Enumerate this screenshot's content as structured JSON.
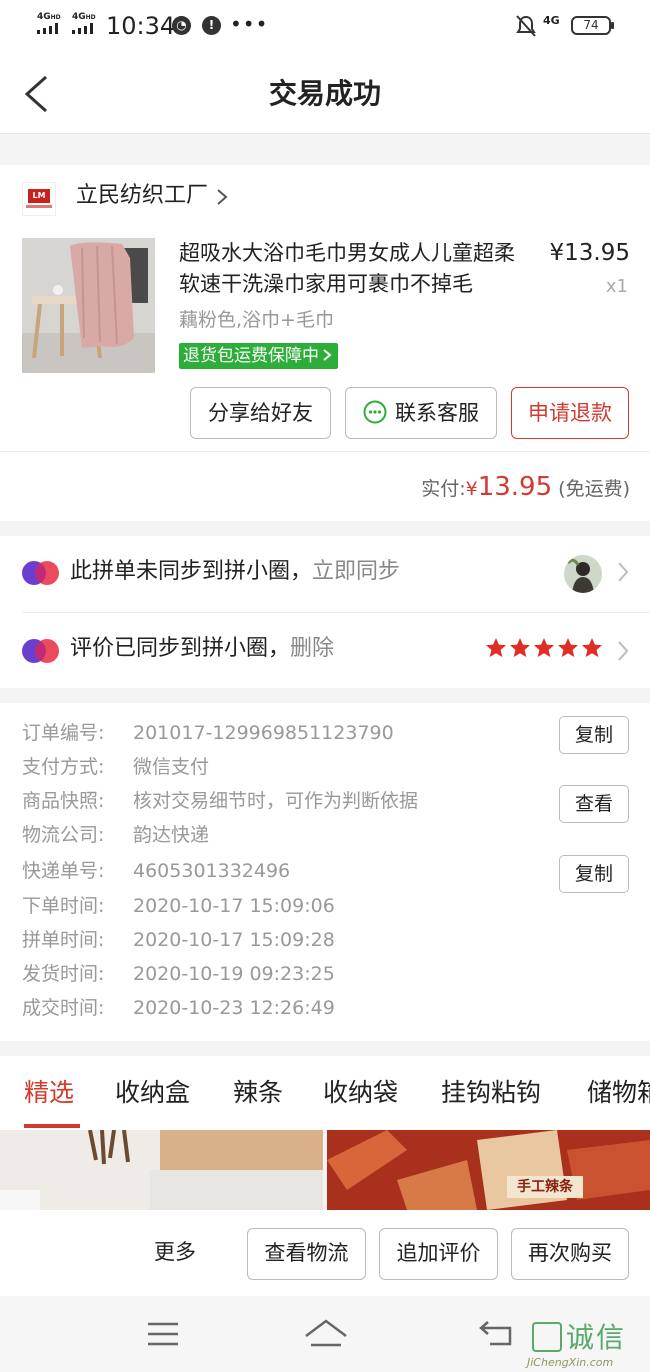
{
  "status_bar": {
    "net1": "4G",
    "net1_sup": "HD",
    "net2": "4G",
    "net2_sup": "HD",
    "time": "10:34",
    "network_right": "4G",
    "battery": "74"
  },
  "header": {
    "title": "交易成功"
  },
  "order": {
    "shop_logo_text": "LM",
    "shop_name": "立民纺织工厂",
    "product_title": "超吸水大浴巾毛巾男女成人儿童超柔软速干洗澡巾家用可裹巾不掉毛",
    "price": "¥13.95",
    "qty": "x1",
    "spec": "藕粉色,浴巾+毛巾",
    "guarantee": "退货包运费保障中",
    "buttons": {
      "share": "分享给好友",
      "contact": "联系客服",
      "refund": "申请退款"
    },
    "total_label": "实付:",
    "total_yen": "¥",
    "total_amount": "13.95",
    "total_note": "(免运费)"
  },
  "sync": {
    "row1_text": "此拼单未同步到拼小圈，",
    "row1_link": "立即同步",
    "row2_text": "评价已同步到拼小圈，",
    "row2_link": "删除",
    "rating": 5
  },
  "details": {
    "order_no_label": "订单编号:",
    "order_no": "201017-129969851123790",
    "copy1": "复制",
    "pay_label": "支付方式:",
    "pay": "微信支付",
    "snapshot_label": "商品快照:",
    "snapshot": "核对交易细节时，可作为判断依据",
    "view": "查看",
    "logistics_label": "物流公司:",
    "logistics": "韵达快递",
    "tracking_label": "快递单号:",
    "tracking": "4605301332496",
    "copy2": "复制",
    "order_time_label": "下单时间:",
    "order_time": "2020-10-17 15:09:06",
    "group_time_label": "拼单时间:",
    "group_time": "2020-10-17 15:09:28",
    "ship_time_label": "发货时间:",
    "ship_time": "2020-10-19 09:23:25",
    "deal_time_label": "成交时间:",
    "deal_time": "2020-10-23 12:26:49"
  },
  "tabs": [
    "精选",
    "收纳盒",
    "辣条",
    "收纳袋",
    "挂钩粘钩",
    "储物箱"
  ],
  "banner": {
    "right_text": "手工辣条"
  },
  "actions": {
    "more": "更多",
    "logistics": "查看物流",
    "review": "追加评价",
    "rebuy": "再次购买"
  },
  "watermark": {
    "text": "诚信",
    "sub": "JiChengXin.com"
  },
  "colors": {
    "accent_red": "#d43a2f",
    "guarantee_green": "#2dae3a"
  }
}
